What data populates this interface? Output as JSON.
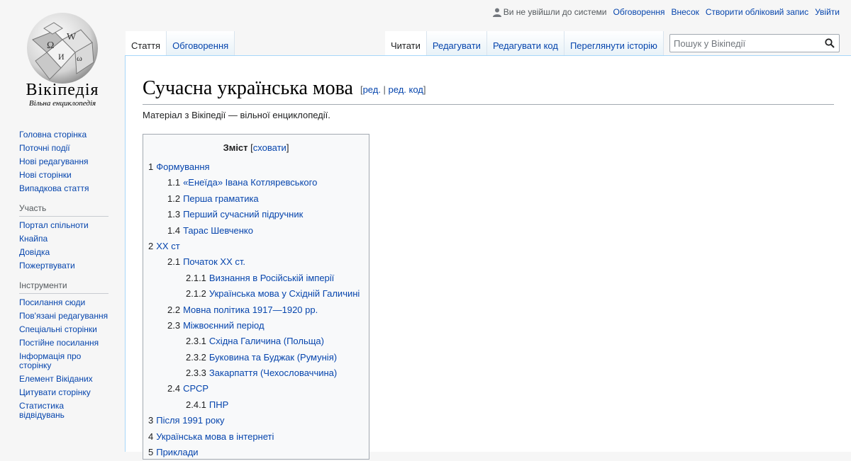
{
  "logo": {
    "wordmark": "Вікіпедія",
    "tagline": "Вільна енциклопедія"
  },
  "sidebar": {
    "navigation": [
      {
        "label": "Головна сторінка"
      },
      {
        "label": "Поточні події"
      },
      {
        "label": "Нові редагування"
      },
      {
        "label": "Нові сторінки"
      },
      {
        "label": "Випадкова стаття"
      }
    ],
    "participation": {
      "heading": "Участь",
      "items": [
        {
          "label": "Портал спільноти"
        },
        {
          "label": "Кнайпа"
        },
        {
          "label": "Довідка"
        },
        {
          "label": "Пожертвувати"
        }
      ]
    },
    "tools": {
      "heading": "Інструменти",
      "items": [
        {
          "label": "Посилання сюди"
        },
        {
          "label": "Пов'язані редагування"
        },
        {
          "label": "Спеціальні сторінки"
        },
        {
          "label": "Постійне посилання"
        },
        {
          "label": "Інформація про сторінку"
        },
        {
          "label": "Елемент Вікіданих"
        },
        {
          "label": "Цитувати сторінку"
        },
        {
          "label": "Статистика відвідувань"
        }
      ]
    }
  },
  "personal": {
    "anon": "Ви не увійшли до системи",
    "talk": "Обговорення",
    "contributions": "Внесок",
    "create_account": "Створити обліковий запис",
    "login": "Увійти"
  },
  "tabs": {
    "article": "Стаття",
    "talk": "Обговорення",
    "read": "Читати",
    "edit": "Редагувати",
    "edit_source": "Редагувати код",
    "history": "Переглянути історію"
  },
  "search": {
    "placeholder": "Пошук у Вікіпедії"
  },
  "article": {
    "title": "Сучасна українська мова",
    "edit_open": "[",
    "edit_link": "ред.",
    "edit_sep": " | ",
    "edit_source_link": "ред. код",
    "edit_close": "]",
    "site_sub": "Матеріал з Вікіпедії — вільної енциклопедії."
  },
  "toc": {
    "title": "Зміст",
    "hide_open": "[",
    "hide": "сховати",
    "hide_close": "]",
    "items": [
      {
        "num": "1",
        "label": "Формування",
        "level": 1
      },
      {
        "num": "1.1",
        "label": "«Енеїда» Івана Котляревського",
        "level": 2
      },
      {
        "num": "1.2",
        "label": "Перша граматика",
        "level": 2
      },
      {
        "num": "1.3",
        "label": "Перший сучасний підручник",
        "level": 2
      },
      {
        "num": "1.4",
        "label": "Тарас Шевченко",
        "level": 2
      },
      {
        "num": "2",
        "label": "XX ст",
        "level": 1
      },
      {
        "num": "2.1",
        "label": "Початок XX ст.",
        "level": 2
      },
      {
        "num": "2.1.1",
        "label": "Визнання в Російській імперії",
        "level": 3
      },
      {
        "num": "2.1.2",
        "label": "Українська мова у Східній Галичині",
        "level": 3
      },
      {
        "num": "2.2",
        "label": "Мовна політика 1917—1920 рр.",
        "level": 2
      },
      {
        "num": "2.3",
        "label": "Міжвоєнний період",
        "level": 2
      },
      {
        "num": "2.3.1",
        "label": "Східна Галичина (Польща)",
        "level": 3
      },
      {
        "num": "2.3.2",
        "label": "Буковина та Буджак (Румунія)",
        "level": 3
      },
      {
        "num": "2.3.3",
        "label": "Закарпаття (Чехословаччина)",
        "level": 3
      },
      {
        "num": "2.4",
        "label": "СРСР",
        "level": 2
      },
      {
        "num": "2.4.1",
        "label": "ПНР",
        "level": 3
      },
      {
        "num": "3",
        "label": "Після 1991 року",
        "level": 1
      },
      {
        "num": "4",
        "label": "Українська мова в інтернеті",
        "level": 1
      },
      {
        "num": "5",
        "label": "Приклади",
        "level": 1
      }
    ]
  }
}
